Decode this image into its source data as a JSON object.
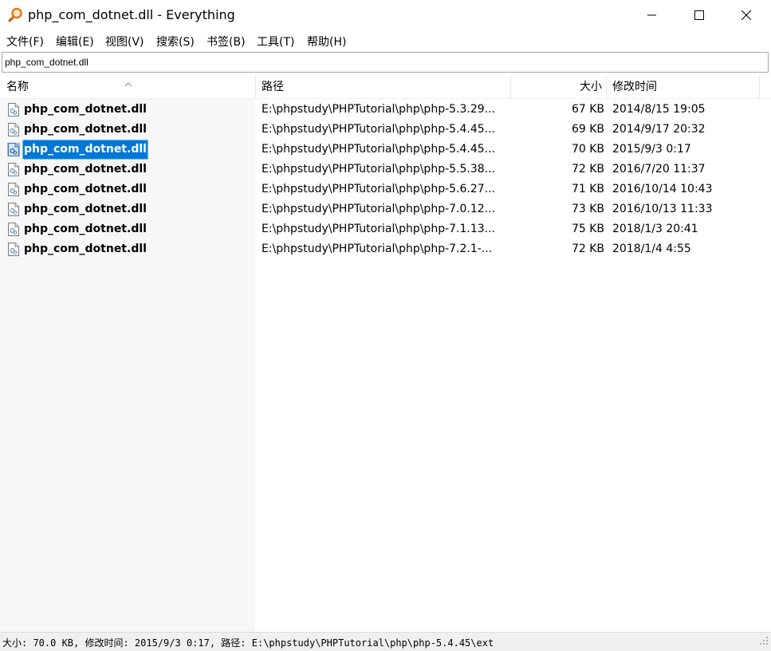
{
  "window": {
    "title": "php_com_dotnet.dll - Everything",
    "icon": "magnifier-icon",
    "minimize_icon": "minimize-icon",
    "maximize_icon": "maximize-icon",
    "close_icon": "close-icon"
  },
  "menu": [
    {
      "label": "文件(F)"
    },
    {
      "label": "编辑(E)"
    },
    {
      "label": "视图(V)"
    },
    {
      "label": "搜索(S)"
    },
    {
      "label": "书签(B)"
    },
    {
      "label": "工具(T)"
    },
    {
      "label": "帮助(H)"
    }
  ],
  "search": {
    "value": "php_com_dotnet.dll"
  },
  "columns": {
    "name": "名称",
    "path": "路径",
    "size": "大小",
    "modified": "修改时间",
    "sort_icon": "sort-ascending-icon"
  },
  "rows": [
    {
      "name": "php_com_dotnet.dll",
      "path": "E:\\phpstudy\\PHPTutorial\\php\\php-5.3.29...",
      "size": "67 KB",
      "modified": "2014/8/15 19:05"
    },
    {
      "name": "php_com_dotnet.dll",
      "path": "E:\\phpstudy\\PHPTutorial\\php\\php-5.4.45...",
      "size": "69 KB",
      "modified": "2014/9/17 20:32"
    },
    {
      "name": "php_com_dotnet.dll",
      "path": "E:\\phpstudy\\PHPTutorial\\php\\php-5.4.45...",
      "size": "70 KB",
      "modified": "2015/9/3 0:17",
      "selected": true
    },
    {
      "name": "php_com_dotnet.dll",
      "path": "E:\\phpstudy\\PHPTutorial\\php\\php-5.5.38...",
      "size": "72 KB",
      "modified": "2016/7/20 11:37"
    },
    {
      "name": "php_com_dotnet.dll",
      "path": "E:\\phpstudy\\PHPTutorial\\php\\php-5.6.27...",
      "size": "71 KB",
      "modified": "2016/10/14 10:43"
    },
    {
      "name": "php_com_dotnet.dll",
      "path": "E:\\phpstudy\\PHPTutorial\\php\\php-7.0.12...",
      "size": "73 KB",
      "modified": "2016/10/13 11:33"
    },
    {
      "name": "php_com_dotnet.dll",
      "path": "E:\\phpstudy\\PHPTutorial\\php\\php-7.1.13...",
      "size": "75 KB",
      "modified": "2018/1/3 20:41"
    },
    {
      "name": "php_com_dotnet.dll",
      "path": "E:\\phpstudy\\PHPTutorial\\php\\php-7.2.1-...",
      "size": "72 KB",
      "modified": "2018/1/4 4:55"
    }
  ],
  "status": {
    "text": "大小: 70.0 KB, 修改时间: 2015/9/3 0:17, 路径: E:\\phpstudy\\PHPTutorial\\php\\php-5.4.45\\ext"
  },
  "colors": {
    "selection": "#0078d7",
    "name_column_bg": "#f7f7f7",
    "status_bg": "#f0f0f0",
    "icon_orange": "#e07a1a"
  }
}
